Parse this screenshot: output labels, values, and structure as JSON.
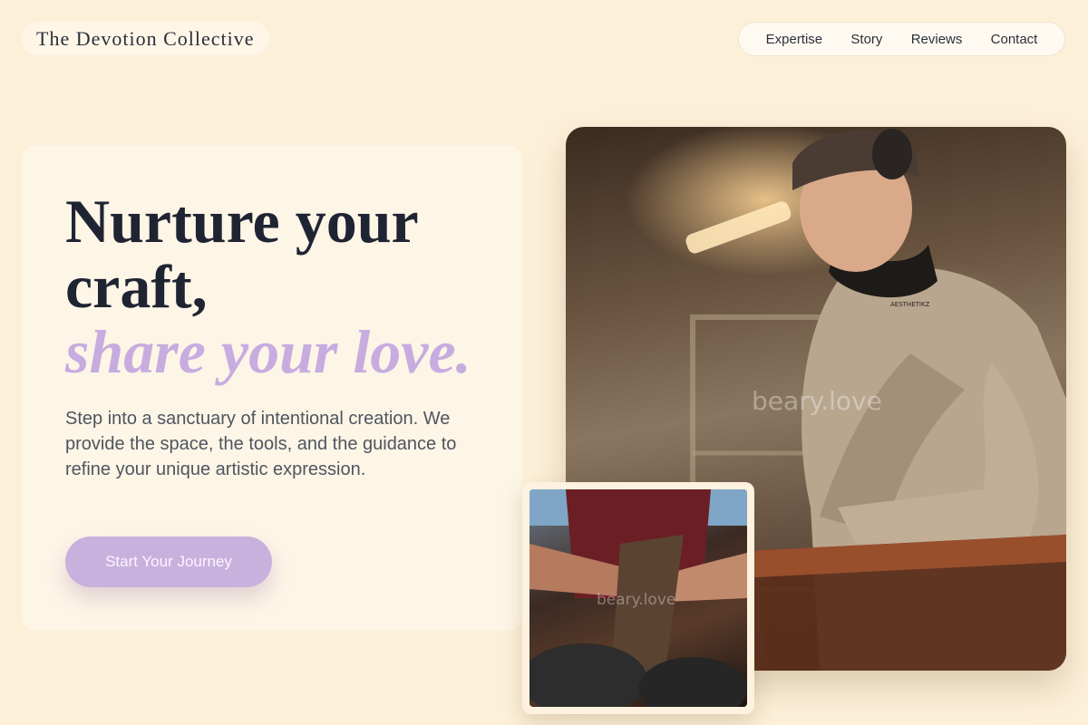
{
  "brand": {
    "name": "The Devotion Collective"
  },
  "nav": {
    "items": [
      {
        "label": "Expertise"
      },
      {
        "label": "Story"
      },
      {
        "label": "Reviews"
      },
      {
        "label": "Contact"
      }
    ]
  },
  "hero": {
    "headline_line1": "Nurture your craft,",
    "headline_accent": "share your love.",
    "lead": "Step into a sanctuary of intentional creation. We provide the space, the tools, and the guidance to refine your unique artistic expression.",
    "cta_label": "Start Your Journey"
  },
  "images": {
    "main_watermark": "beary.love",
    "small_watermark": "beary.love",
    "shirt_print": "AESTHETIKZ"
  },
  "colors": {
    "background": "#fdf0d9",
    "accent": "#c7ace0",
    "cta": "#c9b1dd",
    "text_dark": "#1f2433"
  }
}
